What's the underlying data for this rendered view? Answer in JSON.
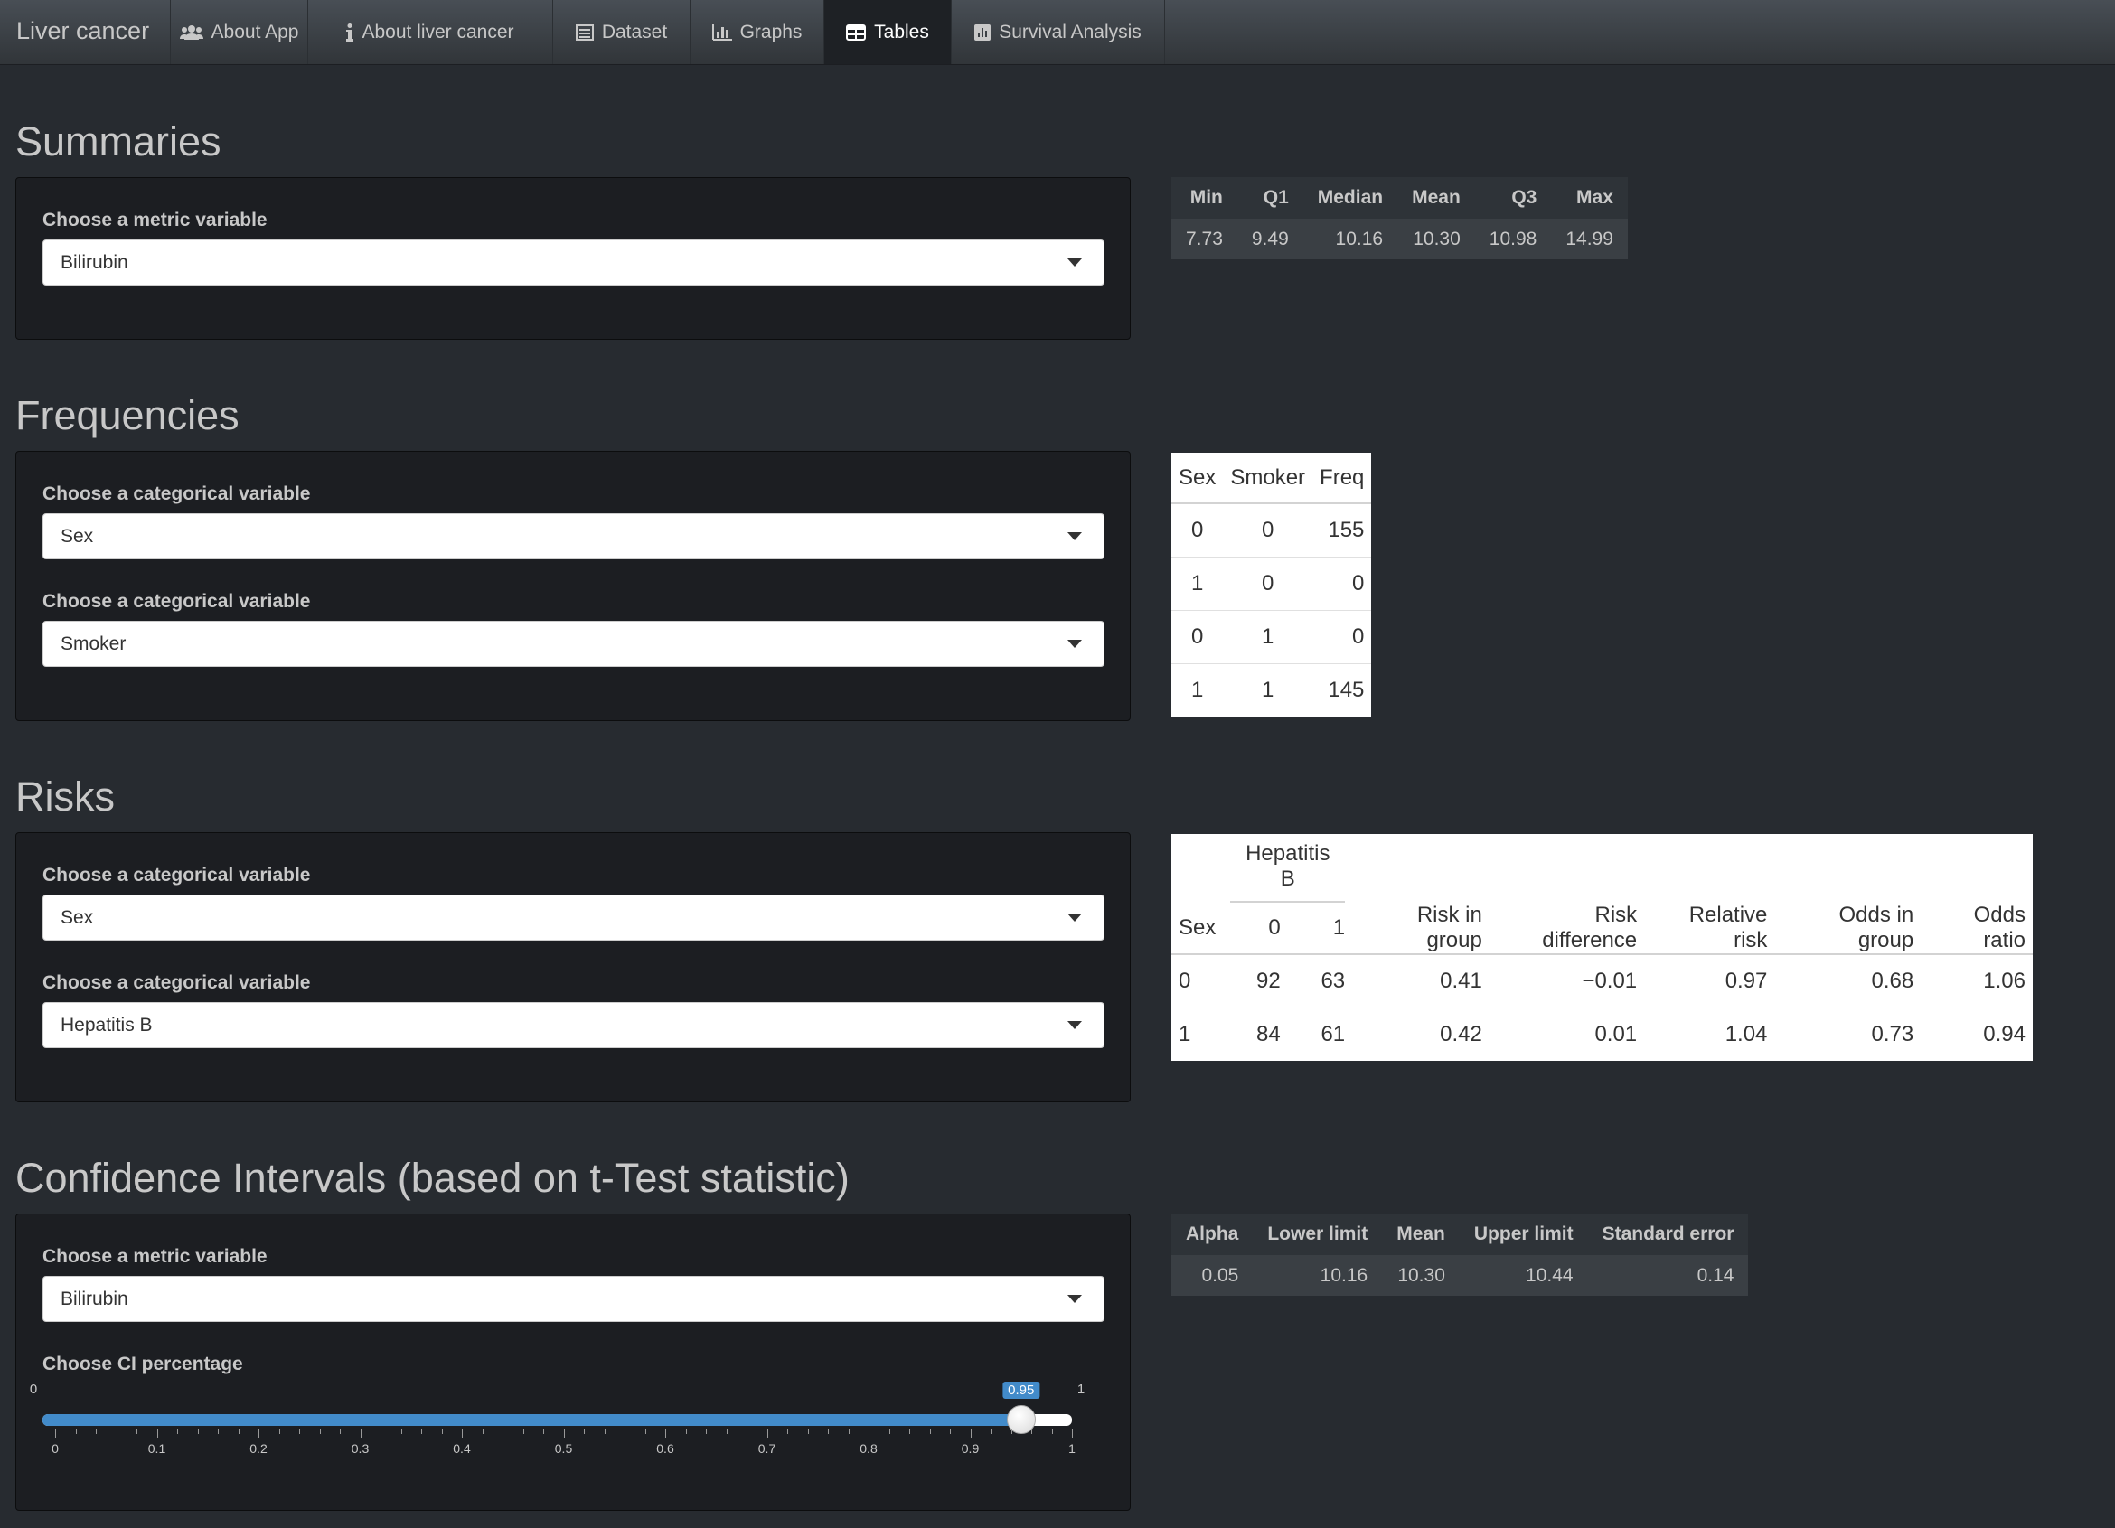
{
  "navbar": {
    "brand": "Liver cancer",
    "tabs": [
      {
        "label": "About App",
        "icon": "users-icon"
      },
      {
        "label": "About liver cancer",
        "icon": "info-icon"
      },
      {
        "label": "Dataset",
        "icon": "list-icon"
      },
      {
        "label": "Graphs",
        "icon": "bar-chart-icon"
      },
      {
        "label": "Tables",
        "icon": "table-icon",
        "active": true
      },
      {
        "label": "Survival Analysis",
        "icon": "chart-icon"
      }
    ]
  },
  "summaries": {
    "title": "Summaries",
    "label": "Choose a metric variable",
    "selected": "Bilirubin",
    "table": {
      "headers": [
        "Min",
        "Q1",
        "Median",
        "Mean",
        "Q3",
        "Max"
      ],
      "values": [
        "7.73",
        "9.49",
        "10.16",
        "10.30",
        "10.98",
        "14.99"
      ]
    }
  },
  "frequencies": {
    "title": "Frequencies",
    "label1": "Choose a categorical variable",
    "selected1": "Sex",
    "label2": "Choose a categorical variable",
    "selected2": "Smoker",
    "table": {
      "headers": [
        "Sex",
        "Smoker",
        "Freq"
      ],
      "rows": [
        [
          "0",
          "0",
          "155"
        ],
        [
          "1",
          "0",
          "0"
        ],
        [
          "0",
          "1",
          "0"
        ],
        [
          "1",
          "1",
          "145"
        ]
      ]
    }
  },
  "risks": {
    "title": "Risks",
    "label1": "Choose a categorical variable",
    "selected1": "Sex",
    "label2": "Choose a categorical variable",
    "selected2": "Hepatitis B",
    "table": {
      "group_header": "Hepatitis B",
      "headers": [
        "Sex",
        "0",
        "1",
        "Risk in group",
        "Risk difference",
        "Relative risk",
        "Odds in group",
        "Odds ratio"
      ],
      "rows": [
        [
          "0",
          "92",
          "63",
          "0.41",
          "−0.01",
          "0.97",
          "0.68",
          "1.06"
        ],
        [
          "1",
          "84",
          "61",
          "0.42",
          "0.01",
          "1.04",
          "0.73",
          "0.94"
        ]
      ]
    }
  },
  "ci": {
    "title": "Confidence Intervals (based on t-Test statistic)",
    "label": "Choose a metric variable",
    "selected": "Bilirubin",
    "slider_label": "Choose CI percentage",
    "slider": {
      "min": 0,
      "max": 1,
      "value": 0.95,
      "min_label": "0",
      "max_label": "1",
      "value_label": "0.95",
      "ticks": [
        "0",
        "0.1",
        "0.2",
        "0.3",
        "0.4",
        "0.5",
        "0.6",
        "0.7",
        "0.8",
        "0.9",
        "1"
      ]
    },
    "table": {
      "headers": [
        "Alpha",
        "Lower limit",
        "Mean",
        "Upper limit",
        "Standard error"
      ],
      "values": [
        "0.05",
        "10.16",
        "10.30",
        "10.44",
        "0.14"
      ]
    }
  },
  "colors": {
    "background": "#272b30",
    "panel": "#1c1e22",
    "accent": "#428bca"
  }
}
